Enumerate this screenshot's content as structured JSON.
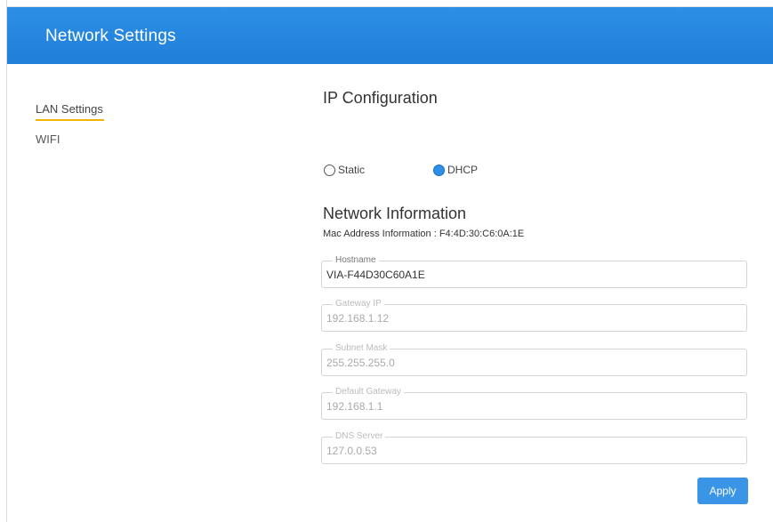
{
  "header": {
    "title": "Network Settings"
  },
  "sidebar": {
    "items": [
      {
        "label": "LAN Settings",
        "active": true
      },
      {
        "label": "WIFI",
        "active": false
      }
    ],
    "active_underline_color": "#f0b400"
  },
  "ip_configuration": {
    "title": "IP Configuration",
    "options": [
      {
        "label": "Static",
        "checked": false
      },
      {
        "label": "DHCP",
        "checked": true
      }
    ]
  },
  "network_information": {
    "title": "Network Information",
    "mac_label": "Mac Address Information : F4:4D:30:C6:0A:1E",
    "fields": [
      {
        "label": "Hostname",
        "value": "VIA-F44D30C60A1E",
        "enabled": true
      },
      {
        "label": "Gateway IP",
        "value": "192.168.1.12",
        "enabled": false
      },
      {
        "label": "Subnet Mask",
        "value": "255.255.255.0",
        "enabled": false
      },
      {
        "label": "Default Gateway",
        "value": "192.168.1.1",
        "enabled": false
      },
      {
        "label": "DNS Server",
        "value": "127.0.0.53",
        "enabled": false
      }
    ]
  },
  "actions": {
    "apply_label": "Apply"
  },
  "colors": {
    "header": "#2e8fe6",
    "accent": "#3b95e6",
    "radio_selected": "#2e8fe6"
  }
}
